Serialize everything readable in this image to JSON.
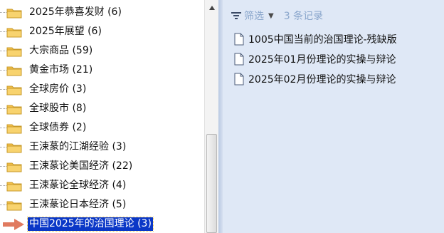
{
  "tree": {
    "items": [
      {
        "label": "2025年恭喜发财 (6)"
      },
      {
        "label": "2025年展望 (6)"
      },
      {
        "label": "大宗商品 (59)"
      },
      {
        "label": "黄金市场 (21)"
      },
      {
        "label": "全球房价 (3)"
      },
      {
        "label": "全球股市 (8)"
      },
      {
        "label": "全球债券 (2)"
      },
      {
        "label": "王涑蒃的江湖经验 (3)"
      },
      {
        "label": "王涑蒃论美国经济 (22)"
      },
      {
        "label": "王涑蒃论全球经济 (4)"
      },
      {
        "label": "王涑蒃论日本经济 (5)"
      },
      {
        "label": "中国2025年的治国理论 (3)",
        "selected": true
      }
    ]
  },
  "filter": {
    "label": "筛选",
    "count": "3 条记录"
  },
  "documents": [
    {
      "label": "1005中国当前的治国理论-残缺版"
    },
    {
      "label": "2025年01月份理论的实操与辩论"
    },
    {
      "label": "2025年02月份理论的实操与辩论"
    }
  ],
  "colors": {
    "selection": "#0a37c7",
    "folder": "#f4c04a",
    "content_background": "#dfe8f6",
    "filter_text": "#8aa6cc",
    "arrow": "#e07a5f"
  },
  "icons": {
    "folder": "folder-icon",
    "document": "document-icon",
    "filter": "filter-icon",
    "scroll_up": "scroll-up-arrow-icon",
    "pointer": "red-arrow-pointer-icon"
  }
}
